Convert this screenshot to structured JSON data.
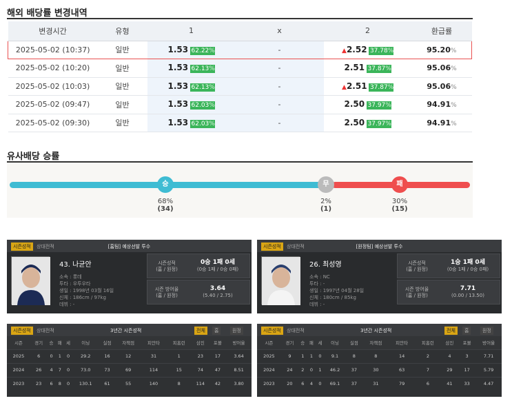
{
  "odds_section": {
    "title": "해외 배당률 변경내역",
    "headers": [
      "변경시간",
      "유형",
      "1",
      "x",
      "2",
      "환급률"
    ],
    "rows": [
      {
        "time": "2025-05-02 (10:37)",
        "type": "일반",
        "o1": "1.53",
        "p1": "62.22",
        "x": "-",
        "o2": "2.52",
        "p2": "37.78",
        "up": true,
        "ref": "95.20",
        "unit": "%",
        "highlight": true
      },
      {
        "time": "2025-05-02 (10:20)",
        "type": "일반",
        "o1": "1.53",
        "p1": "62.13",
        "x": "-",
        "o2": "2.51",
        "p2": "37.87",
        "up": false,
        "ref": "95.06",
        "unit": "%",
        "highlight": false
      },
      {
        "time": "2025-05-02 (10:03)",
        "type": "일반",
        "o1": "1.53",
        "p1": "62.13",
        "x": "-",
        "o2": "2.51",
        "p2": "37.87",
        "up": true,
        "ref": "95.06",
        "unit": "%",
        "highlight": false
      },
      {
        "time": "2025-05-02 (09:47)",
        "type": "일반",
        "o1": "1.53",
        "p1": "62.03",
        "x": "-",
        "o2": "2.50",
        "p2": "37.97",
        "up": false,
        "ref": "94.91",
        "unit": "%",
        "highlight": false
      },
      {
        "time": "2025-05-02 (09:30)",
        "type": "일반",
        "o1": "1.53",
        "p1": "62.03",
        "x": "-",
        "o2": "2.50",
        "p2": "37.97",
        "up": false,
        "ref": "94.91",
        "unit": "%",
        "highlight": false
      }
    ]
  },
  "winrate": {
    "title": "유사배당 승률",
    "win": {
      "label": "승",
      "pct": "68%",
      "count": "(34)",
      "value": 0.68,
      "color": "#3fbcd3"
    },
    "draw": {
      "label": "무",
      "pct": "2%",
      "count": "(1)",
      "value": 0.02,
      "color": "#cccccc"
    },
    "lose": {
      "label": "패",
      "pct": "30%",
      "count": "(15)",
      "value": 0.3,
      "color": "#ef4e4e"
    }
  },
  "pitchers": [
    {
      "tab_on": "시즌성적",
      "tab_off": "상대전적",
      "title": "[홈팀] 예상선발 투수",
      "name": "43. 나균안",
      "info": [
        "소속 : 롯데",
        "투타 : 우투우타",
        "생일 : 1998년 03월 16일",
        "신체 : 186cm / 97kg",
        "데뷔 : -"
      ],
      "rec_label1": "시즌성적",
      "rec_label2": "(홈 / 원정)",
      "rec_main": "0승 1패 0세",
      "rec_sub": "(0승 1패 / 0승 0패)",
      "era_label1": "시즌 방어율",
      "era_label2": "(홈 / 원정)",
      "era_main": "3.64",
      "era_sub": "(5.40 / 2.75)",
      "stats_tab_on": "시즌성적",
      "stats_tab_off": "상대전적",
      "stats_title": "3년간 시즌성적",
      "segs": [
        "전체",
        "홈",
        "원정"
      ],
      "cols": [
        "시즌",
        "경기",
        "승",
        "패",
        "세",
        "이닝",
        "실점",
        "자책점",
        "피안타",
        "피홈런",
        "삼진",
        "포볼",
        "방어율"
      ],
      "rows": [
        [
          "2025",
          "6",
          "0",
          "1",
          "0",
          "29.2",
          "16",
          "12",
          "31",
          "1",
          "23",
          "17",
          "3.64"
        ],
        [
          "2024",
          "26",
          "4",
          "7",
          "0",
          "73.0",
          "73",
          "69",
          "114",
          "15",
          "74",
          "47",
          "8.51"
        ],
        [
          "2023",
          "23",
          "6",
          "8",
          "0",
          "130.1",
          "61",
          "55",
          "140",
          "8",
          "114",
          "42",
          "3.80"
        ]
      ]
    },
    {
      "tab_on": "시즌성적",
      "tab_off": "상대전적",
      "title": "[원정팀] 예상선발 투수",
      "name": "26. 최성영",
      "info": [
        "소속 : NC",
        "투타 : -",
        "생일 : 1997년 04월 28일",
        "신체 : 180cm / 85kg",
        "데뷔 : -"
      ],
      "rec_label1": "시즌성적",
      "rec_label2": "(홈 / 원정)",
      "rec_main": "1승 1패 0세",
      "rec_sub": "(0승 1패 / 0승 0패)",
      "era_label1": "시즌 방어율",
      "era_label2": "(홈 / 원정)",
      "era_main": "7.71",
      "era_sub": "(0.00 / 13.50)",
      "stats_tab_on": "시즌성적",
      "stats_tab_off": "상대전적",
      "stats_title": "3년간 시즌성적",
      "segs": [
        "전체",
        "홈",
        "원정"
      ],
      "cols": [
        "시즌",
        "경기",
        "승",
        "패",
        "세",
        "이닝",
        "실점",
        "자책점",
        "피안타",
        "피홈런",
        "삼진",
        "포볼",
        "방어율"
      ],
      "rows": [
        [
          "2025",
          "9",
          "1",
          "1",
          "0",
          "9.1",
          "8",
          "8",
          "14",
          "2",
          "4",
          "3",
          "7.71"
        ],
        [
          "2024",
          "24",
          "2",
          "0",
          "1",
          "46.2",
          "37",
          "30",
          "63",
          "7",
          "29",
          "17",
          "5.79"
        ],
        [
          "2023",
          "20",
          "6",
          "4",
          "0",
          "69.1",
          "37",
          "31",
          "79",
          "6",
          "41",
          "33",
          "4.47"
        ]
      ]
    }
  ]
}
